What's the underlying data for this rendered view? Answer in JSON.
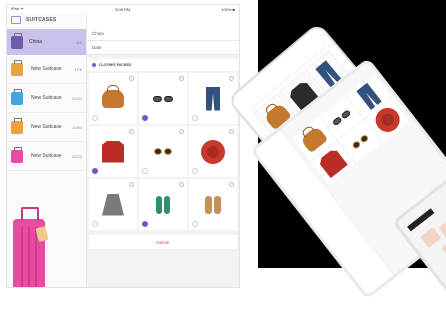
{
  "status_bar": {
    "carrier": "iPad ᯤ",
    "time": "3:08 PM",
    "battery": "100% ■"
  },
  "sidebar": {
    "title": "SUITCASES",
    "active": {
      "name": "China",
      "count": "6/9"
    },
    "items": [
      {
        "name": "New Suitcase",
        "count": "17/6",
        "color": "#e7a33c"
      },
      {
        "name": "New Suitcase",
        "count": "22/30",
        "color": "#3fa7e0"
      },
      {
        "name": "New Suitcase",
        "count": "10/84",
        "color": "#f2a03a"
      },
      {
        "name": "New Suitcase",
        "count": "45/20",
        "color": "#e84ba1"
      }
    ]
  },
  "detail": {
    "fields": [
      {
        "label": "China"
      },
      {
        "label": "Date"
      }
    ],
    "packed_label": "CLOTHES PACKED",
    "delete_label": "Delete",
    "items": [
      {
        "icon": "bag-icon",
        "checked": false
      },
      {
        "icon": "glasses-icon",
        "checked": true
      },
      {
        "icon": "jeans-icon",
        "checked": false
      },
      {
        "icon": "sweater-icon",
        "checked": true
      },
      {
        "icon": "sunglasses-icon",
        "checked": false
      },
      {
        "icon": "hat-icon",
        "checked": false
      },
      {
        "icon": "skirt-icon",
        "checked": false
      },
      {
        "icon": "green-shoes-icon",
        "checked": true
      },
      {
        "icon": "brown-shoes-icon",
        "checked": false
      }
    ]
  },
  "colors": {
    "accent": "#7a4fd0",
    "active_row": "#c9c0ec",
    "delete": "#e0465a"
  }
}
